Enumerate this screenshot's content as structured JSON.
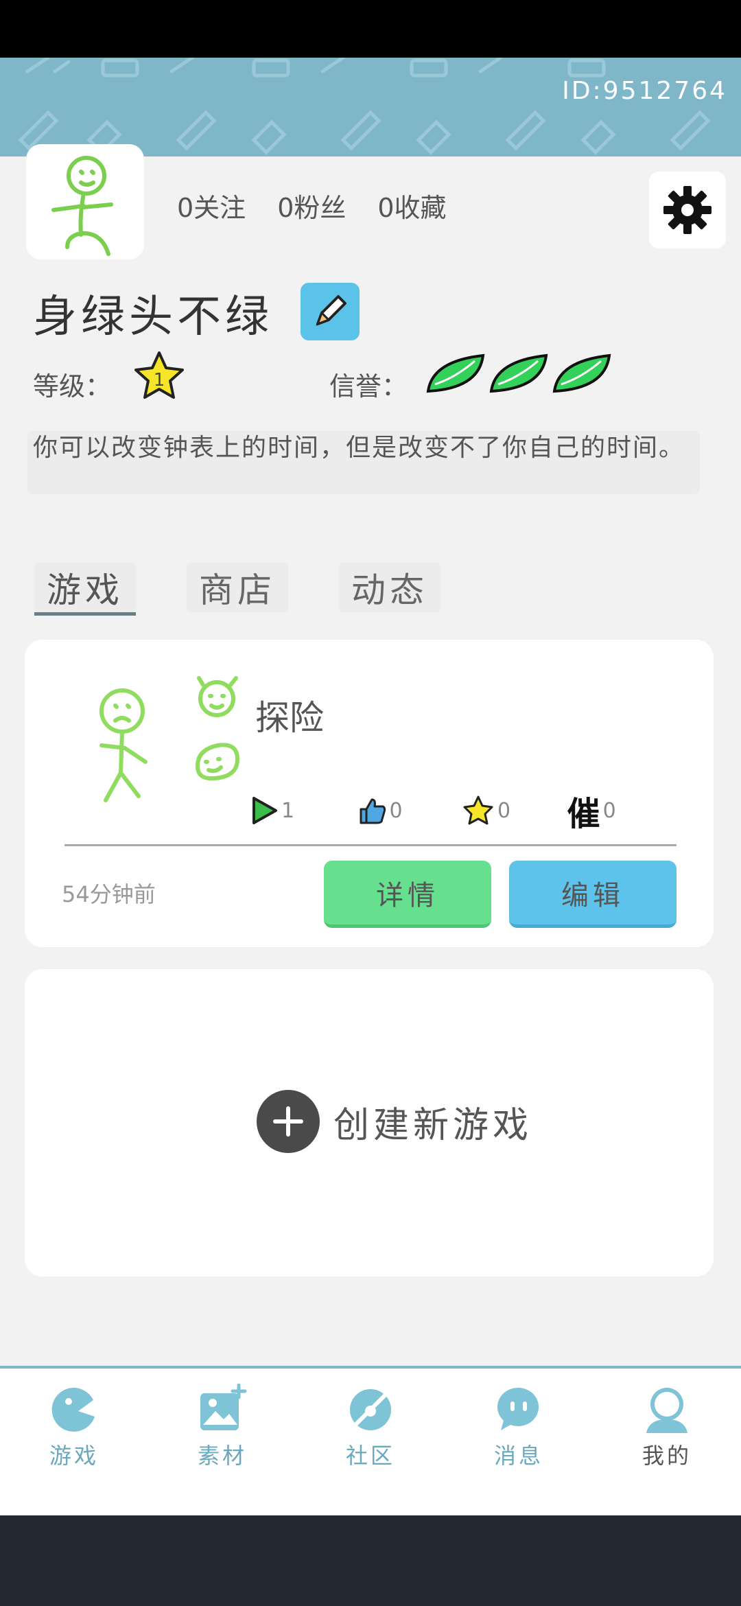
{
  "header": {
    "uid": "ID:9512764"
  },
  "profile": {
    "stats": [
      "0关注",
      "0粉丝",
      "0收藏"
    ],
    "name": "身绿头不绿",
    "level_label": "等级：",
    "level_value": "1",
    "credit_label": "信誉：",
    "credit_leaves": 3,
    "bio": "你可以改变钟表上的时间，但是改变不了你自己的时间。"
  },
  "tabs": [
    "游戏",
    "商店",
    "动态"
  ],
  "active_tab": "游戏",
  "game": {
    "title": "探险",
    "plays": "1",
    "likes": "0",
    "favorites": "0",
    "urge_label": "催",
    "urges": "0",
    "time": "54分钟前",
    "detail_label": "详情",
    "edit_label": "编辑"
  },
  "create": {
    "label": "创建新游戏"
  },
  "nav": [
    {
      "label": "游戏",
      "icon": "game-icon"
    },
    {
      "label": "素材",
      "icon": "material-icon"
    },
    {
      "label": "社区",
      "icon": "community-icon"
    },
    {
      "label": "消息",
      "icon": "message-icon"
    },
    {
      "label": "我的",
      "icon": "profile-icon"
    }
  ],
  "colors": {
    "banner": "#7fb7c9",
    "accent_blue": "#5dc3ea",
    "accent_green": "#66e08e",
    "leaf_green": "#2fcf58"
  }
}
